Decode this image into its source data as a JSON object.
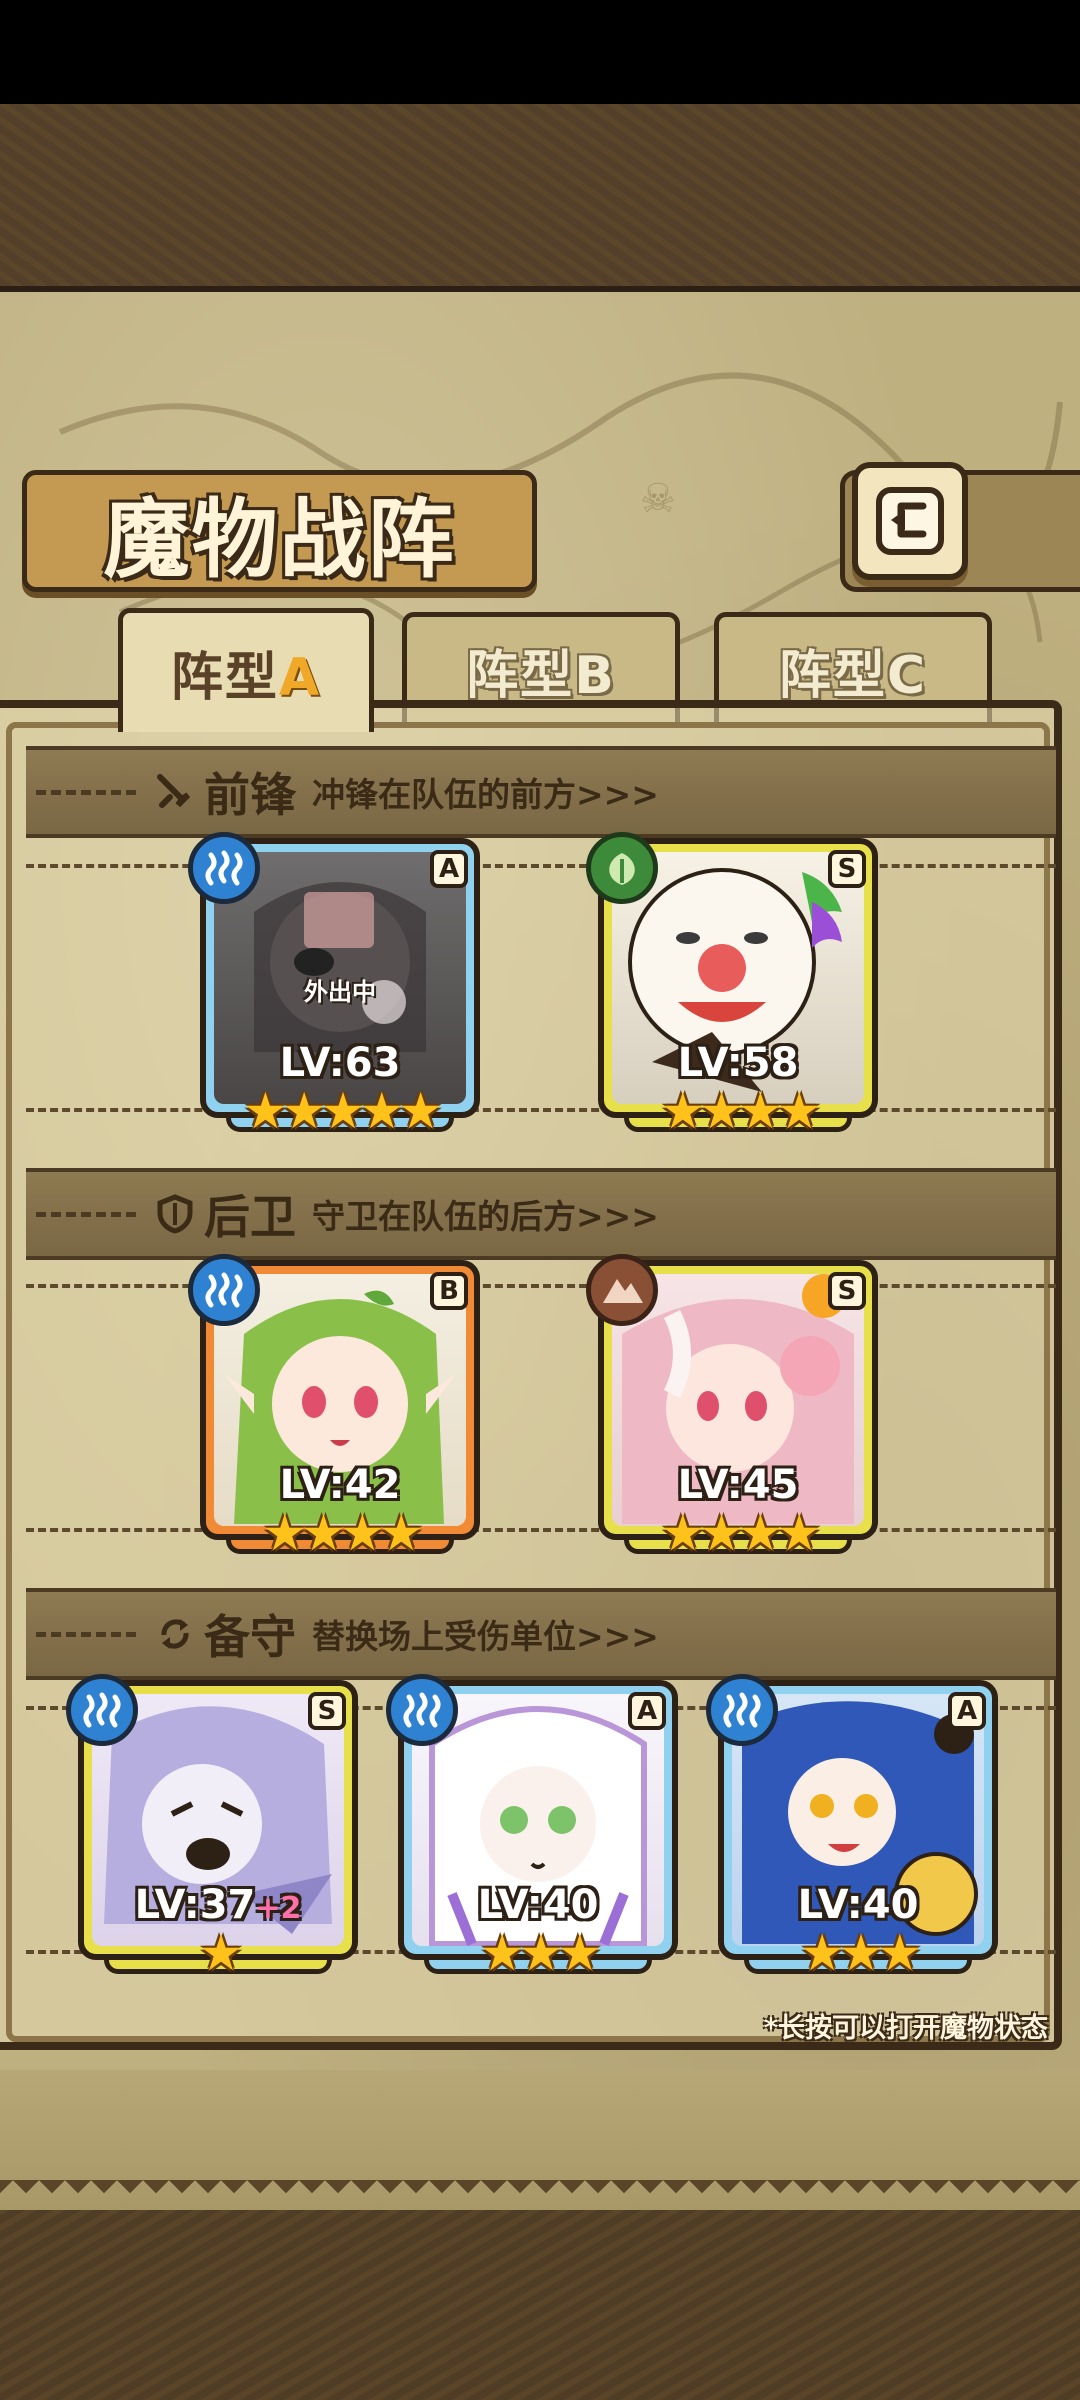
{
  "title": "魔物战阵",
  "back_button": {
    "icon": "return-arrow-icon"
  },
  "tabs": [
    {
      "prefix": "阵型",
      "letter": "A",
      "active": true
    },
    {
      "prefix": "阵型",
      "letter": "B",
      "active": false
    },
    {
      "prefix": "阵型",
      "letter": "C",
      "active": false
    }
  ],
  "sections": {
    "front": {
      "title": "前锋",
      "description": "冲锋在队伍的前方>>>",
      "icon": "sword-icon"
    },
    "rear": {
      "title": "后卫",
      "description": "守卫在队伍的后方>>>",
      "icon": "shield-icon"
    },
    "reserve": {
      "title": "备守",
      "description": "替换场上受伤单位>>>",
      "icon": "swap-icon"
    }
  },
  "monsters": {
    "front_1": {
      "level": "LV:63",
      "stars": "★★★★★",
      "rank": "A",
      "element": "water",
      "status": "外出中"
    },
    "front_2": {
      "level": "LV:58",
      "stars": "★★★★",
      "rank": "S",
      "element": "wood"
    },
    "rear_1": {
      "level": "LV:42",
      "stars": "★★★★",
      "rank": "B",
      "element": "water"
    },
    "rear_2": {
      "level": "LV:45",
      "stars": "★★★★",
      "rank": "S",
      "element": "earth"
    },
    "reserve_1": {
      "level": "LV:37",
      "bonus": "+2",
      "stars": "★",
      "rank": "S",
      "element": "water"
    },
    "reserve_2": {
      "level": "LV:40",
      "stars": "★★★",
      "rank": "A",
      "element": "water"
    },
    "reserve_3": {
      "level": "LV:40",
      "stars": "★★★",
      "rank": "A",
      "element": "water"
    }
  },
  "hint": "*长按可以打开魔物状态",
  "colors": {
    "rank_a": "#8fd1ef",
    "rank_s": "#e7e04a",
    "rank_b": "#f08a35",
    "star": "#ffc21a",
    "frame": "#3b2a17"
  }
}
